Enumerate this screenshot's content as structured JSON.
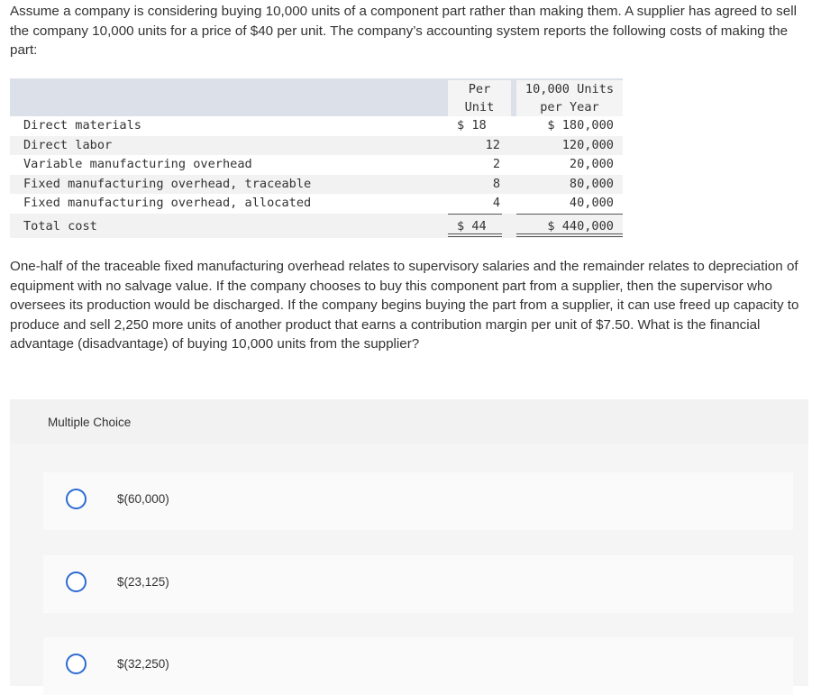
{
  "intro": "Assume a company is considering buying 10,000 units of a component part rather than making them. A supplier has agreed to sell the company 10,000 units for a price of $40 per unit. The company’s accounting system reports the following costs of making the part:",
  "table": {
    "col1_header_line1": "Per",
    "col1_header_line2": "Unit",
    "col2_header_line1": "10,000 Units",
    "col2_header_line2": "per Year",
    "rows": [
      {
        "label": "Direct materials",
        "per_unit": "$ 18",
        "per_year": "$ 180,000"
      },
      {
        "label": "Direct labor",
        "per_unit": "12",
        "per_year": "120,000"
      },
      {
        "label": "Variable manufacturing overhead",
        "per_unit": "2",
        "per_year": "20,000"
      },
      {
        "label": "Fixed manufacturing overhead, traceable",
        "per_unit": "8",
        "per_year": "80,000"
      },
      {
        "label": "Fixed manufacturing overhead, allocated",
        "per_unit": "4",
        "per_year": "40,000"
      }
    ],
    "total": {
      "label": "Total cost",
      "per_unit": "$ 44",
      "per_year": "$ 440,000"
    }
  },
  "question": "One-half of the traceable fixed manufacturing overhead relates to supervisory salaries and the remainder relates to depreciation of equipment with no salvage value. If the company chooses to buy this component part from a supplier, then the supervisor who oversees its production would be discharged. If the company begins buying the part from a supplier, it can use freed up capacity to produce and sell 2,250 more units of another product that earns a contribution margin per unit of $7.50. What is the financial advantage (disadvantage) of buying 10,000 units from the supplier?",
  "multiple_choice": {
    "label": "Multiple Choice",
    "options": [
      "$(60,000)",
      "$(23,125)",
      "$(32,250)"
    ]
  },
  "colors": {
    "radio_border": "#2d6bd2",
    "table_header_bg": "#dbe0e9",
    "panel_bg": "#f2f2f2"
  }
}
